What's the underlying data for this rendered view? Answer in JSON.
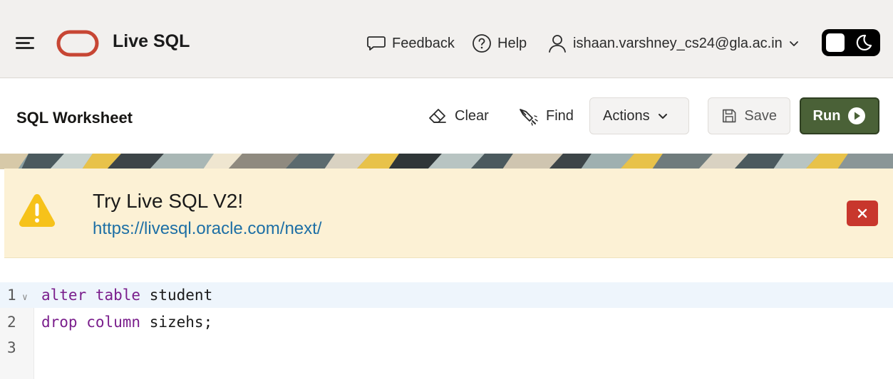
{
  "app": {
    "title": "Live SQL"
  },
  "header": {
    "feedback_label": "Feedback",
    "help_label": "Help",
    "user_email": "ishaan.varshney_cs24@gla.ac.in"
  },
  "toolbar": {
    "title": "SQL Worksheet",
    "clear_label": "Clear",
    "find_label": "Find",
    "actions_label": "Actions",
    "save_label": "Save",
    "run_label": "Run"
  },
  "alert": {
    "title": "Try Live SQL V2!",
    "link": "https://livesql.oracle.com/next/"
  },
  "editor": {
    "line_numbers": [
      "1",
      "2",
      "3"
    ],
    "lines": [
      {
        "keywords": "alter table",
        "rest": " student"
      },
      {
        "keywords": "drop column",
        "rest": " sizehs;"
      },
      {
        "keywords": "",
        "rest": ""
      }
    ]
  },
  "colors": {
    "run_button": "#4a6137",
    "alert_background": "#fcf1d5",
    "close_button": "#c8372d",
    "keyword": "#7a1e8c",
    "link": "#1d6fa5",
    "oracle_logo": "#c74634"
  }
}
